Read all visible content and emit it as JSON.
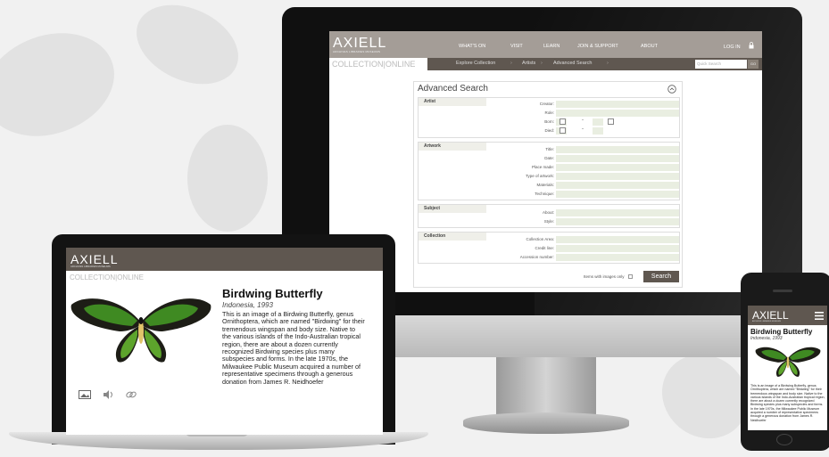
{
  "brand": {
    "name": "AXIELL",
    "tagline": "ARCHIVES LIBRARIES MUSEUMS",
    "colors": {
      "header": "#a49d97",
      "subheader": "#5f5750",
      "field": "#e9eee1"
    }
  },
  "desktop": {
    "nav": [
      "WHAT'S ON",
      "VISIT",
      "LEARN",
      "JOIN & SUPPORT",
      "ABOUT"
    ],
    "login": "LOG IN",
    "collection_label": "COLLECTION|ONLINE",
    "breadcrumbs": [
      "Explore Collection",
      "Artists",
      "Advanced Search"
    ],
    "quick_search_placeholder": "Quick Search",
    "quick_search_go": "GO",
    "advanced_search": {
      "title": "Advanced Search",
      "sections": [
        {
          "title": "Artist",
          "fields": [
            "Creator:",
            "Role:",
            "Born:",
            "Died:"
          ]
        },
        {
          "title": "Artwork",
          "fields": [
            "Title:",
            "Date:",
            "Place made:",
            "Type of artwork:",
            "Materials:",
            "Technique:"
          ]
        },
        {
          "title": "Subject",
          "fields": [
            "About:",
            "Style:"
          ]
        },
        {
          "title": "Collection",
          "fields": [
            "Collection Area:",
            "Credit line:",
            "Accession number:"
          ]
        }
      ],
      "images_only_label": "Items with images only",
      "search_button": "Search"
    }
  },
  "laptop": {
    "collection_label": "COLLECTION|ONLINE",
    "object_title": "Birdwing Butterfly",
    "object_subtitle": "Indonesia, 1993",
    "description": "This is an image of a Birdwing Butterfly, genus Ornithoptera, which are named \"Birdwing\" for their tremendous wingspan and body size.  Native to the various islands of the Indo-Australian tropical region, there are about a dozen currently recognized Birdwing species plus many subspecies and forms.  In the late 1970s, the Milwaukee Public Museum acquired a number of representative specimens through a generous donation from James R. Neidhoefer"
  },
  "phone": {
    "object_title": "Birdwing Butterfly",
    "object_subtitle": "Indonesia, 1993",
    "description": "This is an image of a Birdwing Butterfly, genus Ornithoptera, which are named \"Birdwing\" for their tremendous wingspan and body size. Native to the various islands of the Indo-Australian tropical region, there are about a dozen currently recognized Birdwing species plus many subspecies and forms. In the late 1970s, the Milwaukee Public Museum acquired a number of representative specimens through a generous donation from James R. Neidhoefer"
  }
}
